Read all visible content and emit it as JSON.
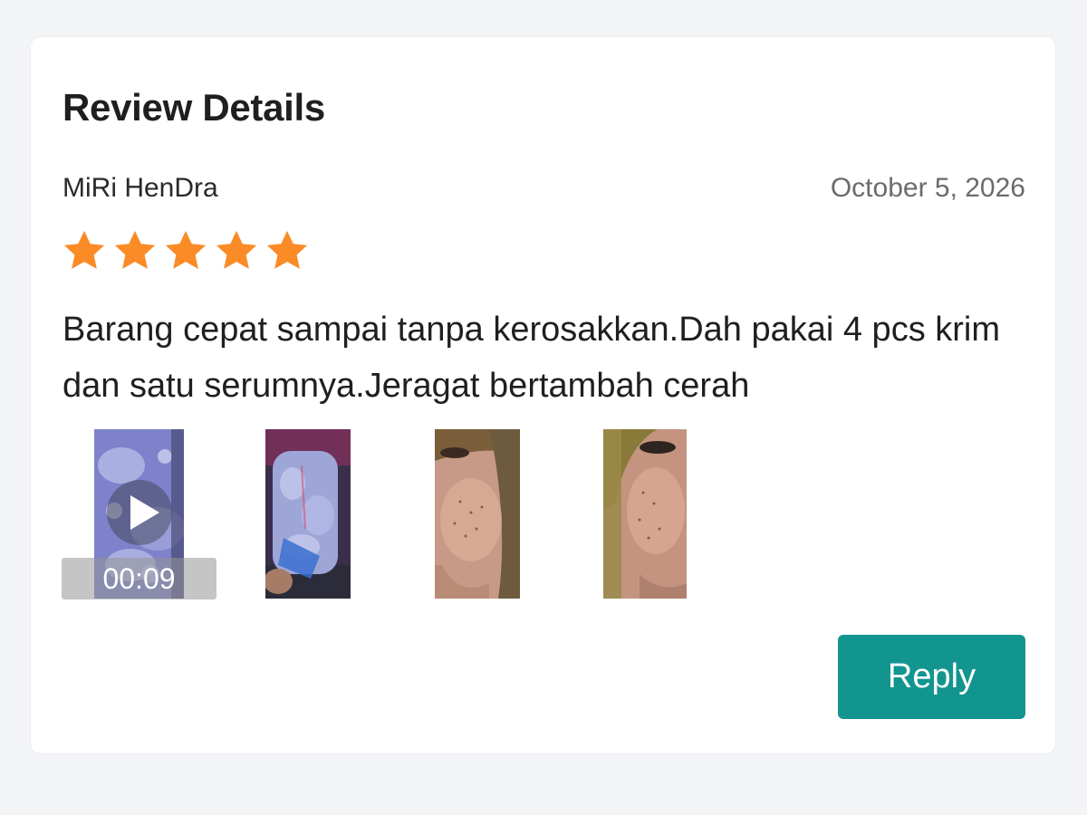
{
  "card": {
    "title": "Review Details"
  },
  "review": {
    "reviewer_name": "MiRi HenDra",
    "date": "October 5, 2026",
    "rating": 5,
    "rating_max": 5,
    "star_color": "#fa8b26",
    "comment": "Barang cepat sampai tanpa kerosakkan.Dah pakai 4 pcs krim dan satu serumnya.Jeragat bertambah cerah"
  },
  "media": {
    "video_duration": "00:09",
    "play_icon": "play-icon",
    "items": [
      {
        "type": "video",
        "subject": "bubble-wrapped package"
      },
      {
        "type": "image",
        "subject": "bubble-wrapped package in hand"
      },
      {
        "type": "image",
        "subject": "face close-up"
      },
      {
        "type": "image",
        "subject": "face close-up"
      }
    ]
  },
  "actions": {
    "reply_label": "Reply",
    "reply_color": "#12958f"
  }
}
